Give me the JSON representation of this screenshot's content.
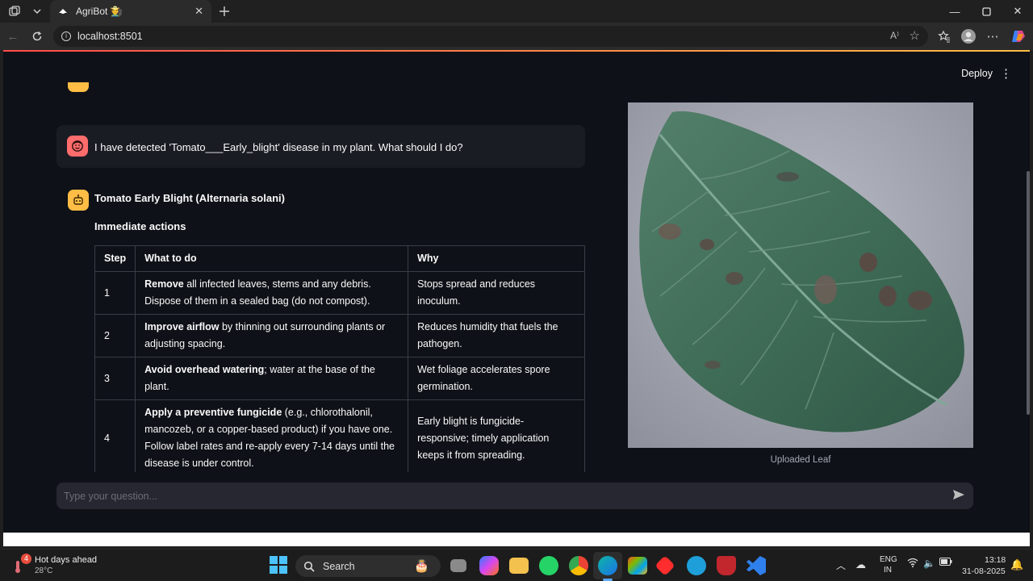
{
  "browser": {
    "tab_title": "AgriBot 🧑‍🌾",
    "url": "localhost:8501",
    "read_aloud_label": "A⁾"
  },
  "app": {
    "deploy_label": "Deploy",
    "user_message": "I have detected 'Tomato___Early_blight' disease in my plant. What should I do?",
    "bot_title": "Tomato Early Blight (Alternaria solani)",
    "bot_subtitle": "Immediate actions",
    "table": {
      "headers": [
        "Step",
        "What to do",
        "Why"
      ],
      "rows": [
        {
          "step": "1",
          "bold": "Remove",
          "rest": " all infected leaves, stems and any debris. Dispose of them in a sealed bag (do not compost).",
          "why": "Stops spread and reduces inoculum."
        },
        {
          "step": "2",
          "bold": "Improve airflow",
          "rest": " by thinning out surrounding plants or adjusting spacing.",
          "why": "Reduces humidity that fuels the pathogen."
        },
        {
          "step": "3",
          "bold": "Avoid overhead watering",
          "rest": "; water at the base of the plant.",
          "why": "Wet foliage accelerates spore germination."
        },
        {
          "step": "4",
          "bold": "Apply a preventive fungicide",
          "rest": " (e.g., chlorothalonil, mancozeb, or a copper-based product) if you have one. Follow label rates and re-apply every 7-14 days until the disease is under control.",
          "why": "Early blight is fungicide-responsive; timely application keeps it from spreading."
        }
      ]
    },
    "image_caption": "Uploaded Leaf",
    "chat_placeholder": "Type your question..."
  },
  "taskbar": {
    "weather_title": "Hot days ahead",
    "weather_temp": "28°C",
    "weather_badge": "4",
    "search_label": "Search",
    "lang_top": "ENG",
    "lang_bottom": "IN",
    "time": "13:18",
    "date": "31-08-2025"
  },
  "colors": {
    "app_bg": "#0e1117",
    "user_avatar": "#ff6c6c",
    "bot_avatar": "#ffbd45",
    "accent_red": "#ff4b4b"
  }
}
